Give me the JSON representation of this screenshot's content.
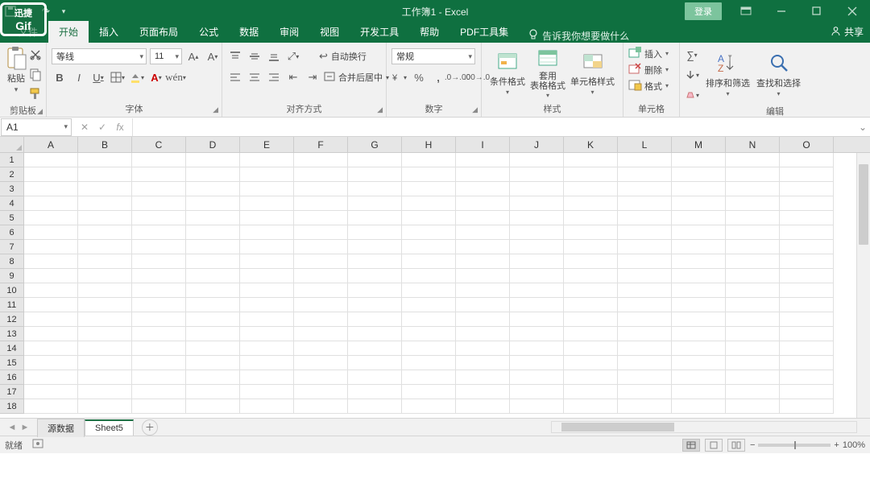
{
  "gif_badge": {
    "line1": "迅捷",
    "line2": "Gif"
  },
  "titlebar": {
    "title": "工作簿1  -  Excel",
    "login": "登录"
  },
  "tabs": {
    "file": "文件",
    "home": "开始",
    "insert": "插入",
    "layout": "页面布局",
    "formulas": "公式",
    "data": "数据",
    "review": "审阅",
    "view": "视图",
    "dev": "开发工具",
    "help": "帮助",
    "pdf": "PDF工具集",
    "tellme": "告诉我你想要做什么",
    "share": "共享"
  },
  "ribbon": {
    "clipboard": {
      "paste": "粘贴",
      "group": "剪贴板"
    },
    "font": {
      "name": "等线",
      "size": "11",
      "group": "字体"
    },
    "align": {
      "wrap": "自动换行",
      "merge": "合并后居中",
      "group": "对齐方式"
    },
    "number": {
      "format": "常规",
      "group": "数字"
    },
    "styles": {
      "cond": "条件格式",
      "table": "套用\n表格格式",
      "cell": "单元格样式",
      "group": "样式"
    },
    "cells": {
      "insert": "插入",
      "delete": "删除",
      "format": "格式",
      "group": "单元格"
    },
    "editing": {
      "sort": "排序和筛选",
      "find": "查找和选择",
      "group": "编辑"
    }
  },
  "cellref": "A1",
  "columns": [
    "A",
    "B",
    "C",
    "D",
    "E",
    "F",
    "G",
    "H",
    "I",
    "J",
    "K",
    "L",
    "M",
    "N",
    "O"
  ],
  "rows": [
    "1",
    "2",
    "3",
    "4",
    "5",
    "6",
    "7",
    "8",
    "9",
    "10",
    "11",
    "12",
    "13",
    "14",
    "15",
    "16",
    "17",
    "18"
  ],
  "sheets": {
    "s1": "源数据",
    "s2": "Sheet5"
  },
  "status": {
    "ready": "就绪",
    "zoom": "100%"
  }
}
